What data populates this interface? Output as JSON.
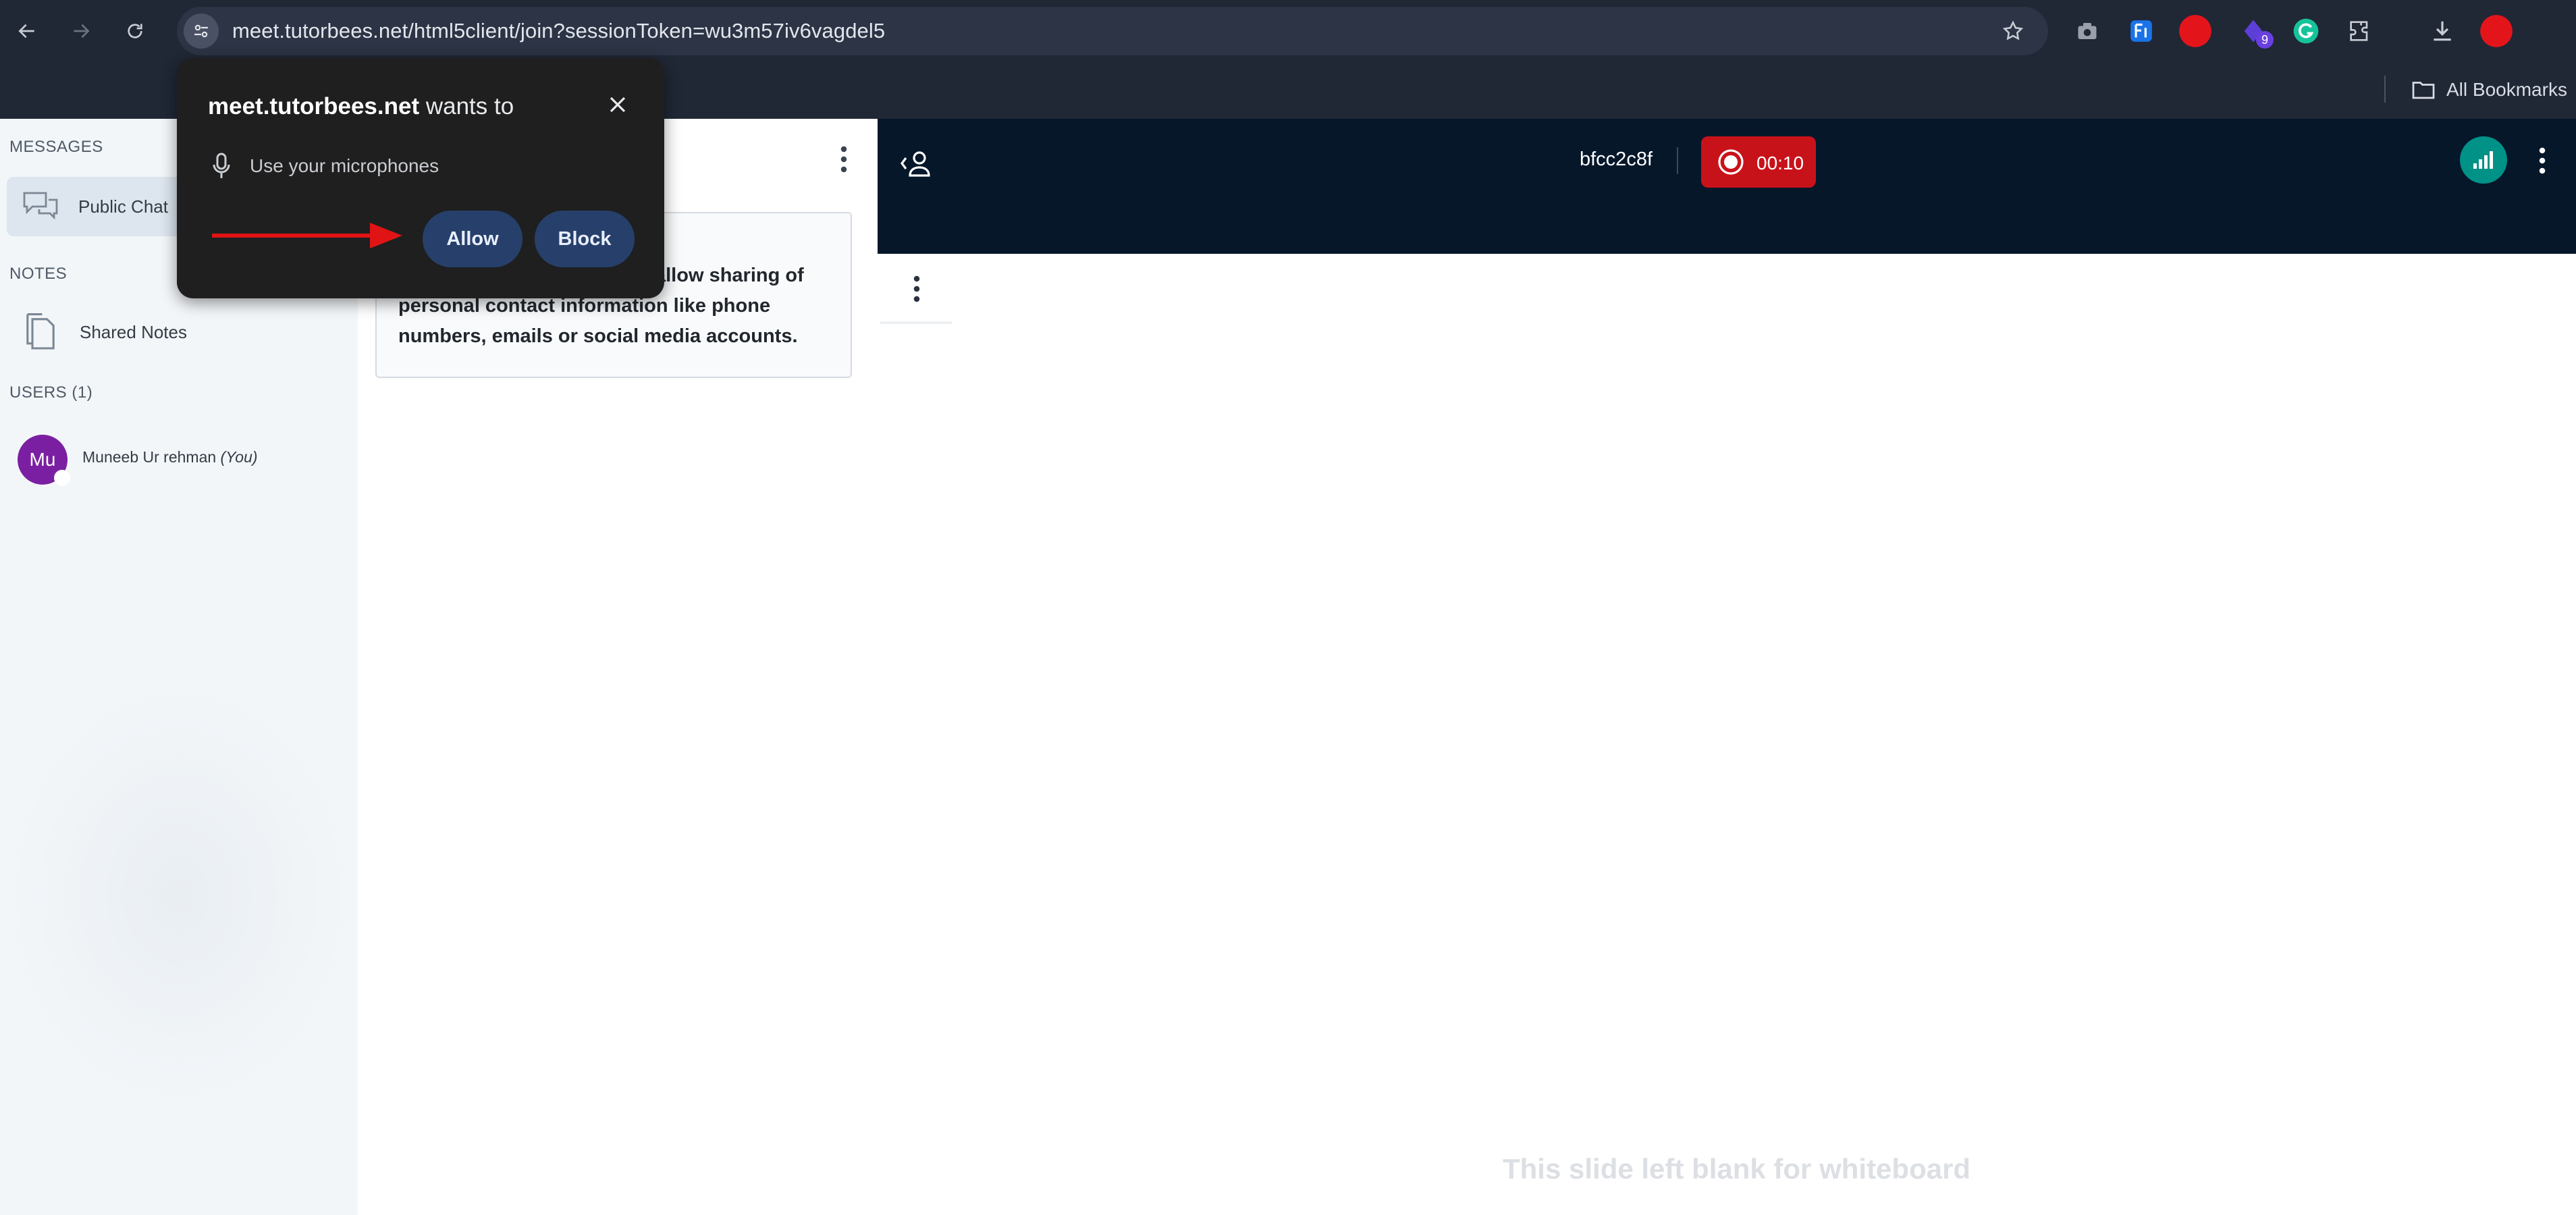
{
  "browser": {
    "url": "meet.tutorbees.net/html5client/join?sessionToken=wu3m57iv6vagdel5",
    "extension_badge": "9",
    "bookmarks_label": "All Bookmarks"
  },
  "permission_prompt": {
    "site": "meet.tutorbees.net",
    "title_suffix": " wants to",
    "request": "Use your microphones",
    "allow_label": "Allow",
    "block_label": "Block"
  },
  "sidebar": {
    "messages_title": "MESSAGES",
    "public_chat_label": "Public Chat",
    "notes_title": "NOTES",
    "shared_notes_label": "Shared Notes",
    "users_title": "USERS (1)",
    "user": {
      "initials": "Mu",
      "name": "Muneeb Ur rehman",
      "you_tag": "(You)"
    }
  },
  "chat": {
    "notice_text": "allow sharing of personal contact information like phone numbers, emails or social media accounts."
  },
  "header": {
    "meeting_name": "bfcc2c8f",
    "recording_time": "00:10"
  },
  "presentation": {
    "blank_note": "This slide left blank for whiteboard"
  },
  "colors": {
    "record_red": "#c8121a",
    "header_navy": "#06172a",
    "connection_teal": "#009187",
    "avatar_purple": "#7b1fa2",
    "prompt_button": "#27406b"
  }
}
